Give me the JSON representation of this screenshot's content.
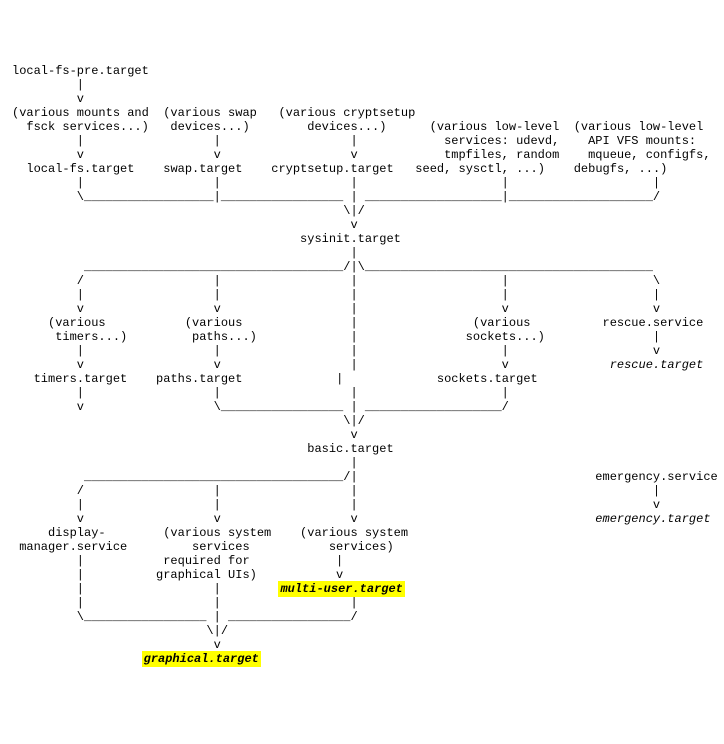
{
  "diagram": {
    "nodes": {
      "local_fs_pre": "local-fs-pre.target",
      "mounts_fsck": "(various mounts and\n  fsck services...)",
      "swap_devices": "(various swap\n devices...)",
      "cryptsetup_devices": "(various cryptsetup\n     devices...)",
      "low_level_services": "(various low-level\n services: udevd,\n tmpfiles, random\n seed, sysctl, ...)",
      "api_vfs_mounts": "(various low-level\n API VFS mounts:\n mqueue, configfs,\n  debugfs, ...)",
      "local_fs": "local-fs.target",
      "swap": "swap.target",
      "cryptsetup": "cryptsetup.target",
      "sysinit": "sysinit.target",
      "timers_grp": "(various\n timers...)",
      "paths_grp": "(various\n paths...)",
      "sockets_grp": "(various\n sockets...)",
      "timers": "timers.target",
      "paths": "paths.target",
      "sockets": "sockets.target",
      "rescue_svc": "rescue.service",
      "rescue": "rescue.target",
      "basic": "basic.target",
      "display_mgr": "display-\nmanager.service",
      "sys_svcs_gfx": "(various system\n   services\n required for\ngraphical UIs)",
      "sys_svcs": "(various system\n   services)",
      "multi_user": "multi-user.target",
      "graphical": "graphical.target",
      "emergency_svc": "emergency.service",
      "emergency": "emergency.target"
    },
    "highlighted": [
      "multi-user.target",
      "graphical.target"
    ],
    "italic_targets": [
      "rescue.target",
      "emergency.target",
      "multi-user.target",
      "graphical.target"
    ]
  }
}
